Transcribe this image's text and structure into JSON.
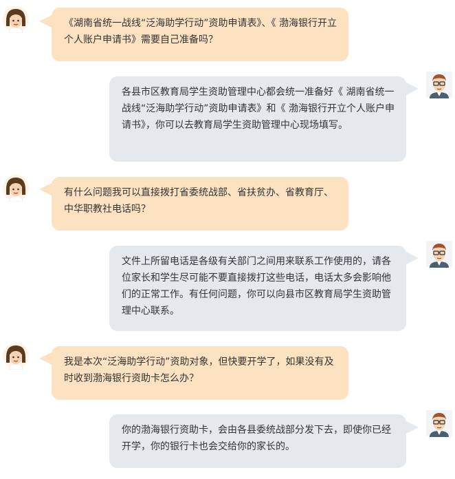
{
  "conversation": {
    "messages": [
      {
        "role": "asker",
        "text": "《湖南省统一战线“泛海助学行动”资助申请表》、《 渤海银行开立个人账户申请书》需要自己准备吗？"
      },
      {
        "role": "answerer",
        "text": "各县市区教育局学生资助管理中心都会统一准备好《 湖南省统一战线“泛海助学行动”资助申请表》和《 渤海银行开立个人账户申请书》，你可以去教育局学生资助管理中心现场填写。"
      },
      {
        "role": "asker",
        "text": "有什么问题我可以直接拨打省委统战部、省扶贫办、省教育厅、中华职教社电话吗？"
      },
      {
        "role": "answerer",
        "text": "文件上所留电话是各级有关部门之间用来联系工作使用的，请各位家长和学生尽可能不要直接拨打这些电话，电话太多会影响他们的正常工作。有任何问题，你可以向县市区教育局学生资助管理中心联系。"
      },
      {
        "role": "asker",
        "text": "我是本次“泛海助学行动”资助对象，但快要开学了，如果没有及时收到渤海银行资助卡怎么办？"
      },
      {
        "role": "answerer",
        "text": "你的渤海银行资助卡，会由各县委统战部分发下去，即使你已经开学，你的银行卡也会交给你的家长的。"
      }
    ]
  },
  "avatars": {
    "asker": "girl-avatar-icon",
    "answerer": "man-with-glasses-avatar-icon"
  },
  "colors": {
    "asker_bubble": "#fde2c2",
    "answerer_bubble": "#e4e9ee",
    "text": "#333333"
  }
}
